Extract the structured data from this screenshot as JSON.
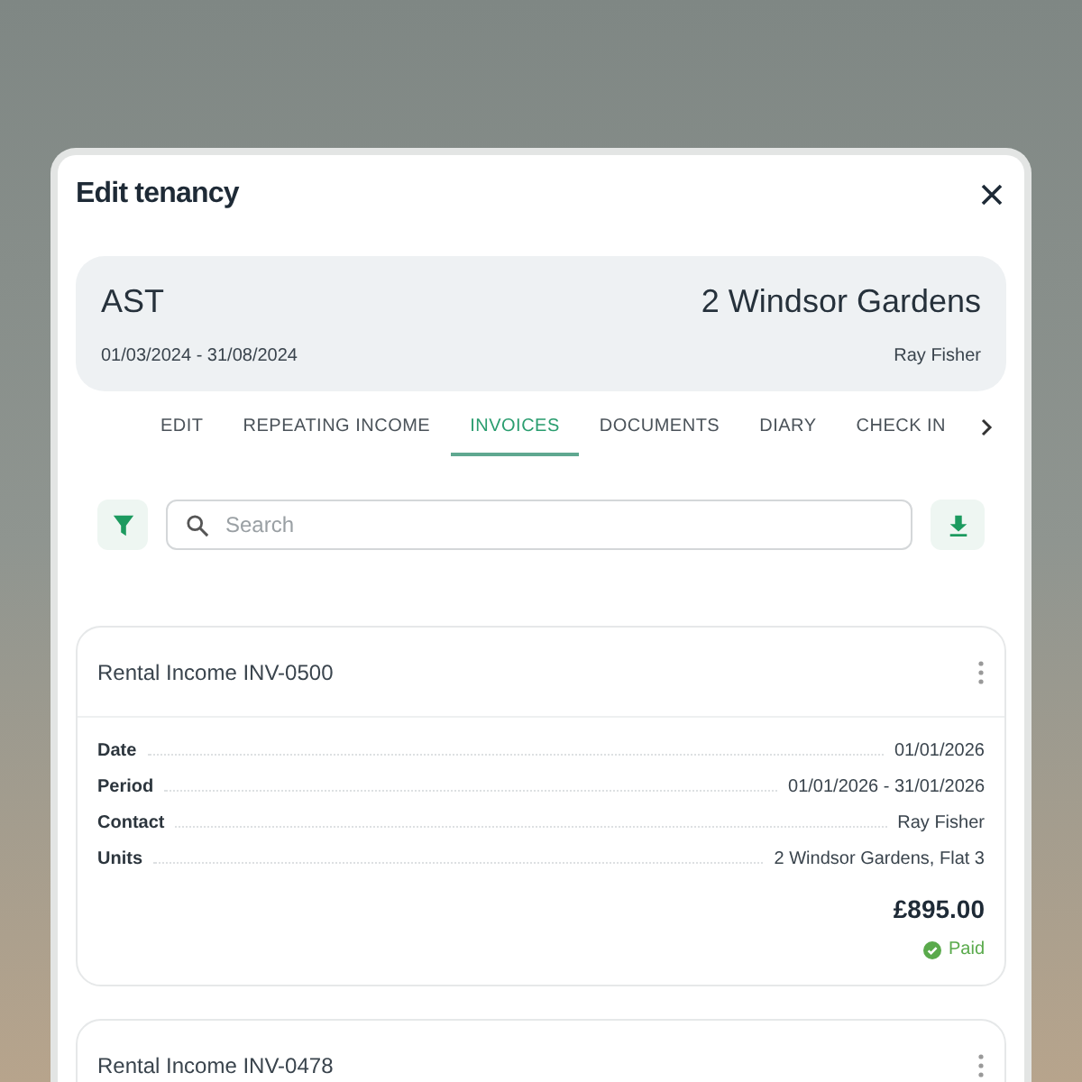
{
  "dialog": {
    "title": "Edit tenancy"
  },
  "tenancy": {
    "type": "AST",
    "property": "2 Windsor Gardens",
    "dates": "01/03/2024 - 31/08/2024",
    "tenant": "Ray Fisher"
  },
  "tabs": [
    {
      "label": "EDIT",
      "selected": false
    },
    {
      "label": "REPEATING INCOME",
      "selected": false
    },
    {
      "label": "INVOICES",
      "selected": true
    },
    {
      "label": "DOCUMENTS",
      "selected": false
    },
    {
      "label": "DIARY",
      "selected": false
    },
    {
      "label": "CHECK IN",
      "selected": false
    }
  ],
  "search": {
    "placeholder": "Search"
  },
  "invoices": [
    {
      "title": "Rental Income INV-0500",
      "fields": [
        {
          "label": "Date",
          "value": "01/01/2026"
        },
        {
          "label": "Period",
          "value": "01/01/2026 - 31/01/2026"
        },
        {
          "label": "Contact",
          "value": "Ray Fisher"
        },
        {
          "label": "Units",
          "value": "2 Windsor Gardens, Flat 3"
        }
      ],
      "amount": "£895.00",
      "status": {
        "label": "Paid",
        "kind": "paid"
      }
    },
    {
      "title": "Rental Income INV-0478"
    }
  ]
}
